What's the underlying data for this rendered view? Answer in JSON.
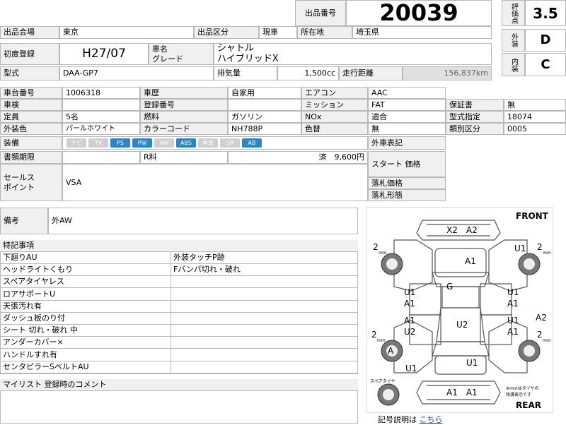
{
  "header": {
    "lot_label": "出品番号",
    "lot_number": "20039",
    "score_label": "評価点",
    "score": "3.5",
    "exterior_label": "外装",
    "exterior_grade": "D",
    "interior_label": "内装",
    "interior_grade": "C"
  },
  "row1": {
    "venue_label": "出品会場",
    "venue": "東京",
    "category_label": "出品区分",
    "category": "現車",
    "location_label": "所在地",
    "location": "埼玉県"
  },
  "vehicle": {
    "first_reg_label": "初度登録",
    "first_reg": "H27/07",
    "name_label": "車名",
    "grade_label": "グレード",
    "name": "シャトル",
    "grade": "ハイブリッドX",
    "model_label": "型式",
    "model": "DAA-GP7",
    "displacement_label": "排気量",
    "displacement": "1,500cc",
    "mileage_label": "走行距離",
    "mileage": "156,837km"
  },
  "details": {
    "chassis_label": "車台番号",
    "chassis": "1006318",
    "history_label": "車歴",
    "history": "自家用",
    "ac_label": "エアコン",
    "ac": "AAC",
    "inspection_label": "車検",
    "inspection": "",
    "regno_label": "登録番号",
    "regno": "",
    "transmission_label": "ミッション",
    "transmission": "FAT",
    "warranty_label": "保証書",
    "warranty": "無",
    "capacity_label": "定員",
    "capacity": "5名",
    "fuel_label": "燃料",
    "fuel": "ガソリン",
    "nox_label": "NOx",
    "nox_value": "適合",
    "type_cert_label": "型式指定",
    "type_cert": "18074",
    "color_label": "外装色",
    "color": "パールホワイト",
    "color_code_label": "カラーコード",
    "color_code": "NH788P",
    "recolor_label": "色替",
    "recolor": "無",
    "class_label": "類別区分",
    "class_code": "0005",
    "equipment_label": "装備",
    "equipment": [
      {
        "name": "ナビ",
        "on": false
      },
      {
        "name": "TV",
        "on": false
      },
      {
        "name": "PS",
        "on": true
      },
      {
        "name": "PW",
        "on": true
      },
      {
        "name": "AW",
        "on": false
      },
      {
        "name": "ABS",
        "on": true
      },
      {
        "name": "本革",
        "on": false
      },
      {
        "name": "SR",
        "on": false
      },
      {
        "name": "AB",
        "on": true
      }
    ],
    "ext_notes_label": "外車表記",
    "docs_label": "書類期限",
    "recycle_label": "R料",
    "recycle_value": "済　9,600円",
    "start_price_label": "スタート 価格",
    "sales_point_label": "セールス\nポイント",
    "sales_point": "VSA",
    "winning_price_label": "落札価格",
    "winning_type_label": "落札形態"
  },
  "remarks": {
    "label": "備考",
    "value": "外AW"
  },
  "special": {
    "title": "特記事項",
    "left": [
      "下廻りAU",
      "ヘッドライトくもり",
      "スペアタイヤレス",
      "ロアサポートU",
      "天張汚れ有",
      "ダッシュ板のり付",
      "シート 切れ・破れ 中",
      "アンダーカバー×",
      "ハンドルすれ有",
      "センタピラーSベルトAU"
    ],
    "right": [
      "外装タッチP跡",
      "Fバンパ切れ・破れ",
      "",
      "",
      "",
      "",
      "",
      "",
      "",
      ""
    ]
  },
  "comment": {
    "title": "マイリスト 登録時のコメント"
  },
  "diagram": {
    "front": "FRONT",
    "rear": "REAR",
    "spare": "スペアタイヤ",
    "tire_note": "※mmはタイヤの\n 残溝表示です",
    "fl_tire": "2",
    "fr_tire": "2",
    "rl_tire": "2",
    "rr_tire": "2",
    "tire_unit": "mm",
    "marks": {
      "front_bumper": "X2　A2",
      "hood": "A1",
      "fr_fender": "U1",
      "roof": "G",
      "l_front_door": "U1\nA1",
      "r_front_door": "U1\nA1",
      "l_rear_door": "A1\nU2",
      "r_rear_door": "U1\nA1",
      "center": "U2",
      "r_quarter": "A2",
      "l_rear_tire": "A",
      "l_rocker": "U1",
      "trunk": "U1",
      "rear_bumper": "A1　A1"
    },
    "legend_label": "記号説明は",
    "legend_link": "こちら"
  }
}
